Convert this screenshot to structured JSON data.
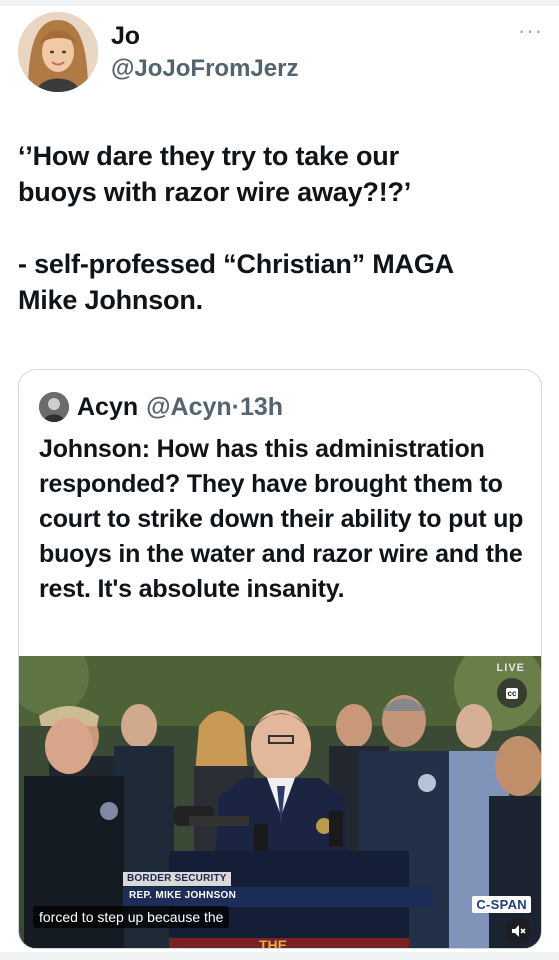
{
  "author": {
    "display_name": "Jo",
    "handle": "@JoJoFromJerz",
    "avatar": "profile-photo"
  },
  "more_icon": "more-dots-icon",
  "tweet": {
    "paragraph1": "‘’How dare they try to take our\nbuoys with razor wire away?!?’",
    "paragraph2": "- self-professed “Christian” MAGA\nMike Johnson."
  },
  "quote": {
    "name": "Acyn",
    "handle": "@Acyn",
    "separator": "·",
    "time": "13h",
    "text": "Johnson: How has this administration responded? They have brought them to court to strike down their ability to put up buoys in the water and razor wire and the rest. It's absolute insanity."
  },
  "video": {
    "live_label": "LIVE",
    "cc_label": "cc",
    "chyron_top": "BORDER SECURITY",
    "chyron_name": "REP. MIKE JOHNSON",
    "caption": "forced to step up because the",
    "network_logo": "C-SPAN",
    "mute_icon": "volume-muted-icon"
  }
}
